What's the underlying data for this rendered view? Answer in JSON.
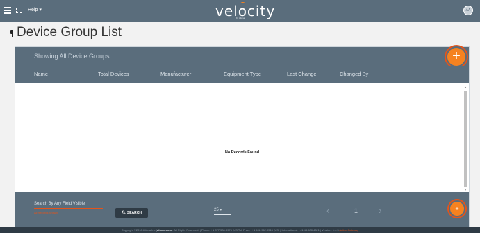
{
  "header": {
    "help_label": "Help ▾",
    "logo_text": "velocity",
    "logo_sub": "by Atlona",
    "avatar_initials": "AA"
  },
  "page": {
    "title": "Device Group List"
  },
  "panel": {
    "heading": "Showing All Device Groups",
    "add_label": "+",
    "columns": [
      "Name",
      "Total Devices",
      "Manufacturer",
      "Equipment Type",
      "Last Change",
      "Changed By"
    ],
    "empty_message": "No Records Found"
  },
  "footer_bar": {
    "search_label": "Search By Any Field Visible",
    "search_hint": "All Records Shown",
    "search_button": "SEARCH",
    "page_size": "25 ▾",
    "prev": "‹",
    "page_number": "1",
    "next": "›",
    "add_label": "+"
  },
  "footer": {
    "copyright": "Copyright ©2018 Atlona Inc (",
    "site": "atlona.com",
    "rest": "). All Rights Reserved. | Phone: +1 877.536.3976 (US Toll Free) | +1 408.962.0515 (US) | International: +41.43.508.4321 | Version: 1.4.3",
    "status": "Active Gateway"
  },
  "colors": {
    "header_bg": "#5a6d7c",
    "accent": "#f58220",
    "accent_ring": "#e5541a",
    "footer_bg": "#2f3b45"
  }
}
